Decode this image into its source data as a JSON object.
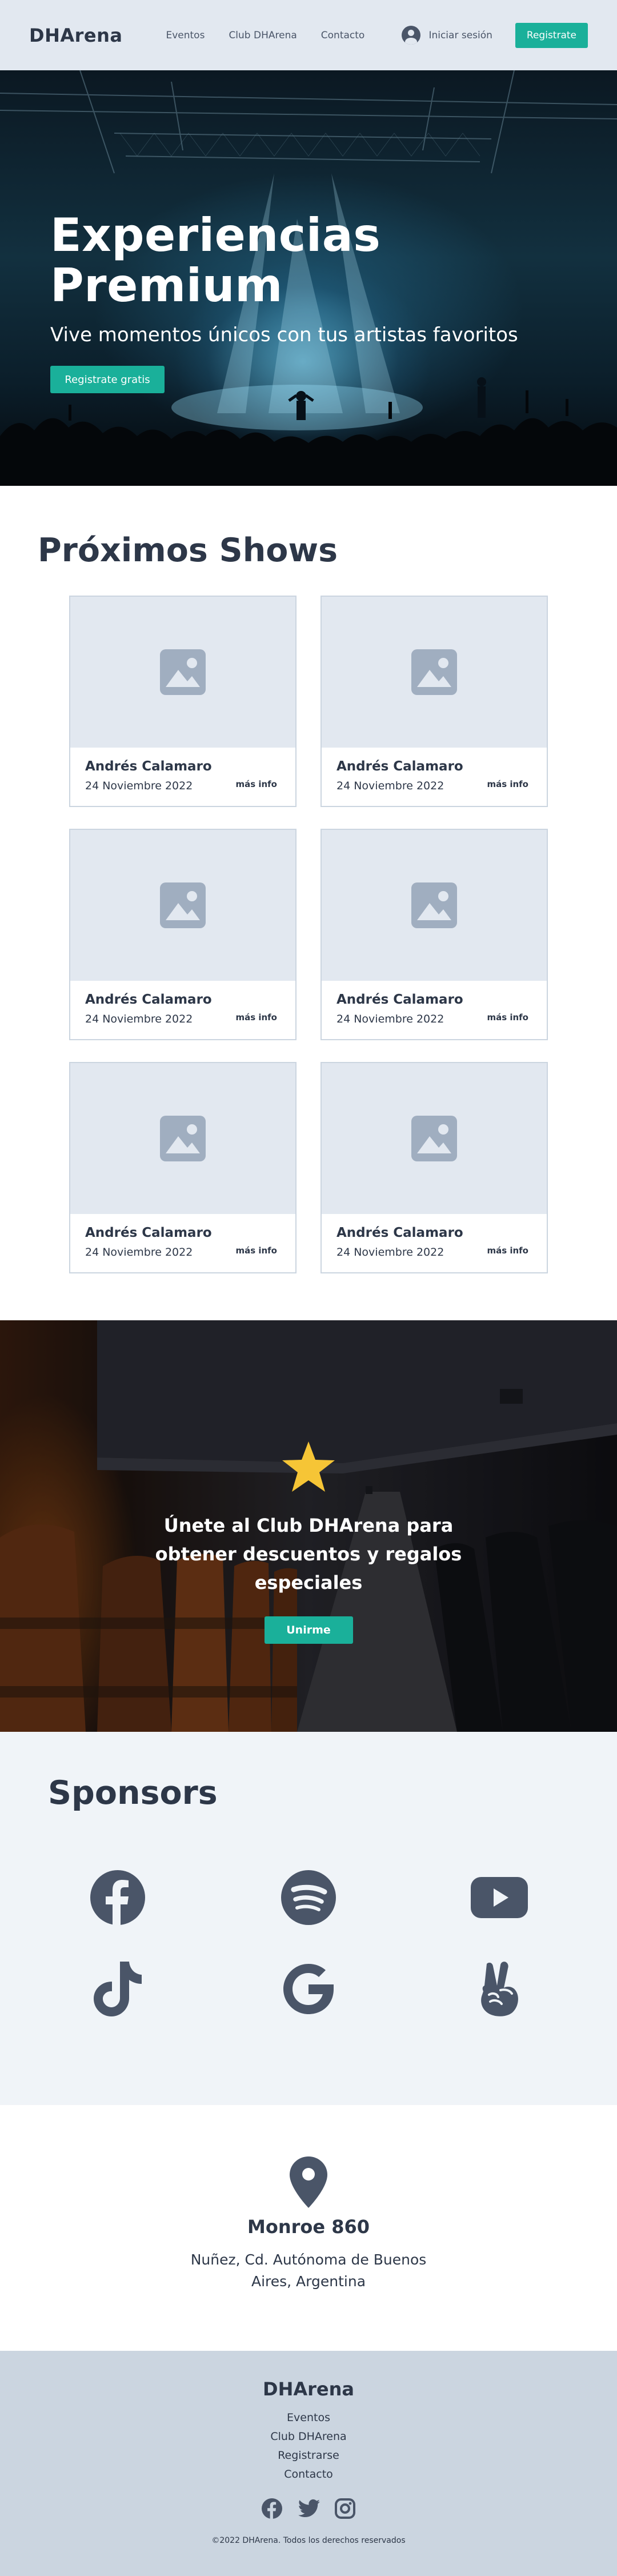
{
  "header": {
    "logo": "DHArena",
    "nav": [
      "Eventos",
      "Club DHArena",
      "Contacto"
    ],
    "login_label": "Iniciar sesión",
    "register_label": "Registrate"
  },
  "hero": {
    "title": "Experiencias Premium",
    "subtitle": "Vive momentos únicos con tus artistas favoritos",
    "cta_label": "Registrate gratis"
  },
  "shows": {
    "title": "Próximos Shows",
    "cards": [
      {
        "title": "Andrés Calamaro",
        "date": "24 Noviembre 2022",
        "more": "más info"
      },
      {
        "title": "Andrés Calamaro",
        "date": "24 Noviembre 2022",
        "more": "más info"
      },
      {
        "title": "Andrés Calamaro",
        "date": "24 Noviembre 2022",
        "more": "más info"
      },
      {
        "title": "Andrés Calamaro",
        "date": "24 Noviembre 2022",
        "more": "más info"
      },
      {
        "title": "Andrés Calamaro",
        "date": "24 Noviembre 2022",
        "more": "más info"
      },
      {
        "title": "Andrés Calamaro",
        "date": "24 Noviembre 2022",
        "more": "más info"
      }
    ]
  },
  "club": {
    "text": "Únete al Club DHArena para obtener descuentos y regalos especiales",
    "cta_label": "Unirme"
  },
  "sponsors": {
    "title": "Sponsors",
    "items": [
      "facebook-icon",
      "spotify-icon",
      "youtube-icon",
      "tiktok-icon",
      "google-icon",
      "victory-hand-icon"
    ]
  },
  "location": {
    "title": "Monroe 860",
    "address": "Nuñez, Cd. Autónoma de Buenos Aires, Argentina"
  },
  "footer": {
    "logo": "DHArena",
    "links": [
      "Eventos",
      "Club DHArena",
      "Registrarse",
      "Contacto"
    ],
    "social": [
      "facebook-icon",
      "twitter-icon",
      "instagram-icon"
    ],
    "copyright": "©2022 DHArena. Todos los derechos reservados"
  },
  "colors": {
    "accent": "#1ab09a",
    "text": "#2d3748",
    "header_bg": "#e2e8f0",
    "footer_bg": "#cbd5e0",
    "icon": "#4a5568",
    "star": "#f6c536"
  }
}
